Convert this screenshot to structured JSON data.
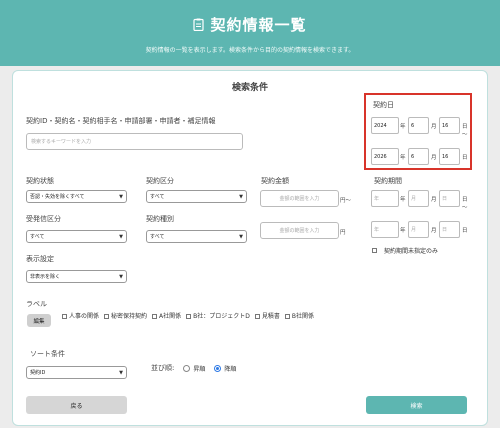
{
  "header": {
    "title": "契約情報一覧",
    "subtitle": "契約情報の一覧を表示します。検索条件から目的の契約情報を検索できます。"
  },
  "search": {
    "title": "検索条件",
    "keyword_label": "契約ID・契約名・契約相手名・申請部署・申請者・補足情報",
    "keyword_placeholder": "検索するキーワードを入力",
    "contract_date": {
      "label": "契約日",
      "from": {
        "year": "2024",
        "year_unit": "年",
        "month": "6",
        "month_unit": "月",
        "day": "16",
        "day_unit": "日"
      },
      "tilde": "〜",
      "to": {
        "year": "2026",
        "year_unit": "年",
        "month": "6",
        "month_unit": "月",
        "day": "16",
        "day_unit": "日"
      }
    },
    "status": {
      "label": "契約状態",
      "value": "否認・失効を除くすべて"
    },
    "category": {
      "label": "契約区分",
      "value": "すべて"
    },
    "amount": {
      "label": "契約金額",
      "from_placeholder": "金額の範囲を入力",
      "from_unit": "円〜",
      "to_placeholder": "金額の範囲を入力",
      "to_unit": "円"
    },
    "period": {
      "label": "契約期間",
      "from": {
        "year": "年",
        "month": "月",
        "day": "日"
      },
      "to": {
        "year": "年",
        "month": "月",
        "day": "日"
      },
      "unit_year": "年",
      "unit_month": "月",
      "unit_day": "日",
      "tilde": "〜",
      "unspecified_label": "契約期間未指定のみ"
    },
    "send_receive": {
      "label": "受発信区分",
      "value": "すべて"
    },
    "contract_type": {
      "label": "契約種別",
      "value": "すべて"
    },
    "display": {
      "label": "表示設定",
      "value": "非表示を除く"
    },
    "labels": {
      "label": "ラベル",
      "edit_button": "編集",
      "items": [
        "人事の関係",
        "秘密保持契約",
        "A社関係",
        "B社：プロジェクトD",
        "見積書",
        "B社関係"
      ]
    },
    "sort": {
      "label": "ソート条件",
      "value": "契約ID",
      "order_label": "並び順:",
      "asc": "昇順",
      "desc": "降順",
      "selected": "desc"
    },
    "back_button": "戻る",
    "search_button": "検索"
  },
  "colors": {
    "accent": "#5db6b1",
    "highlight": "#d8342a"
  }
}
